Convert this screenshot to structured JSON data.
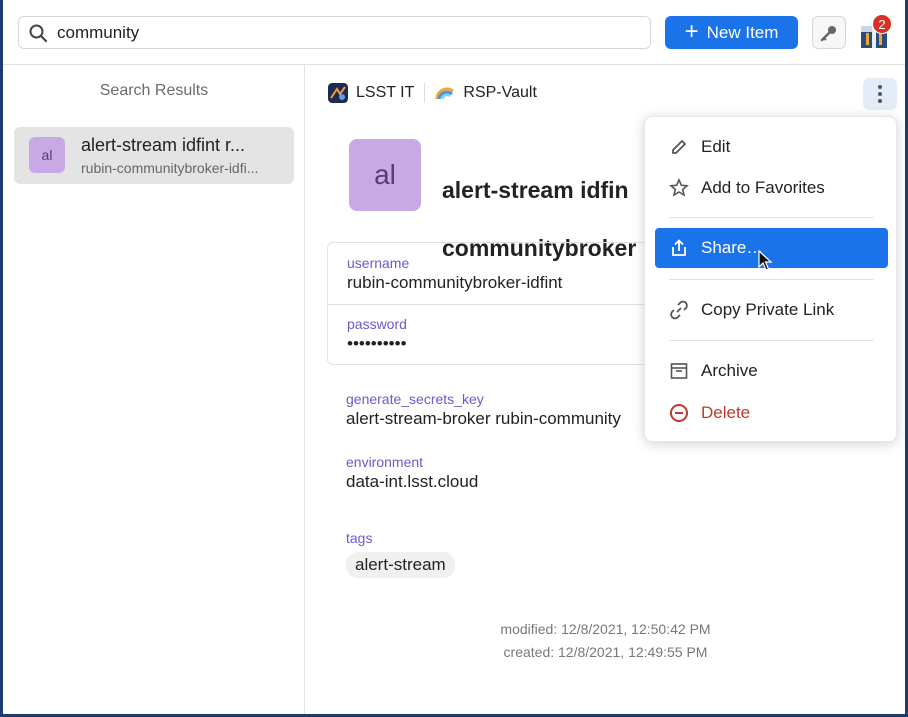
{
  "search": {
    "value": "community",
    "placeholder": ""
  },
  "toolbar": {
    "new_item_label": "New Item",
    "notifications_count": "2"
  },
  "sidebar": {
    "title": "Search Results",
    "results": [
      {
        "avatar": "al",
        "title": "alert-stream idfint r...",
        "subtitle": "rubin-communitybroker-idfi..."
      }
    ]
  },
  "item": {
    "vaults": [
      {
        "name": "LSST IT",
        "icon": "lsst-vault-icon"
      },
      {
        "name": "RSP-Vault",
        "icon": "rsp-vault-icon"
      }
    ],
    "avatar": "al",
    "title_line1": "alert-stream idfin",
    "title_line2": "communitybroker",
    "fields": [
      {
        "label": "username",
        "value": "rubin-communitybroker-idfint"
      },
      {
        "label": "password",
        "value": "••••••••••"
      }
    ],
    "extra_fields": [
      {
        "label": "generate_secrets_key",
        "value": "alert-stream-broker rubin-community"
      },
      {
        "label": "environment",
        "value": "data-int.lsst.cloud"
      }
    ],
    "tags_label": "tags",
    "tags": [
      "alert-stream"
    ],
    "modified": "modified: 12/8/2021, 12:50:42 PM",
    "created": "created: 12/8/2021, 12:49:55 PM"
  },
  "menu": {
    "items": [
      {
        "label": "Edit",
        "icon": "pencil-icon"
      },
      {
        "label": "Add to Favorites",
        "icon": "star-icon"
      },
      {
        "label": "Share…",
        "icon": "share-icon"
      },
      {
        "label": "Copy Private Link",
        "icon": "link-icon"
      },
      {
        "label": "Archive",
        "icon": "archive-icon"
      },
      {
        "label": "Delete",
        "icon": "delete-icon"
      }
    ]
  },
  "colors": {
    "accent": "#1a73e8",
    "danger": "#c0392b",
    "label": "#6a5acd",
    "avatar_bg": "#c9a8e6"
  }
}
